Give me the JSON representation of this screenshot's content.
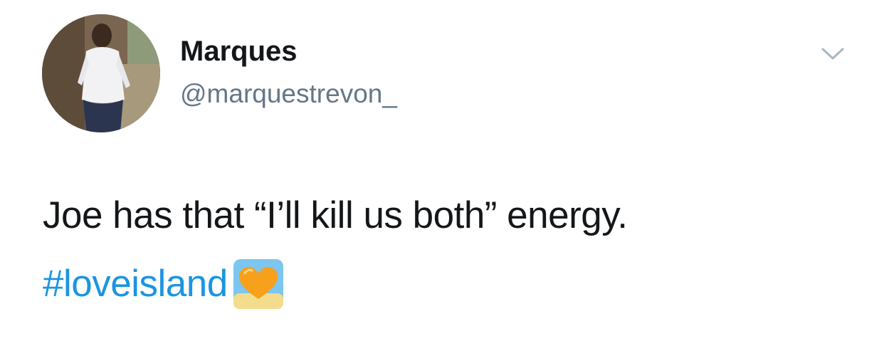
{
  "tweet": {
    "author": {
      "display_name": "Marques",
      "handle": "@marquestrevon_"
    },
    "text": "Joe has that “I’ll kill us both” energy.",
    "hashtag": "#loveisland",
    "emoji": "orange-heart-beach-icon"
  },
  "colors": {
    "text": "#14171a",
    "handle": "#657786",
    "link": "#1b95e0",
    "caret": "#aab8c2",
    "heart": "#f7a01b"
  }
}
